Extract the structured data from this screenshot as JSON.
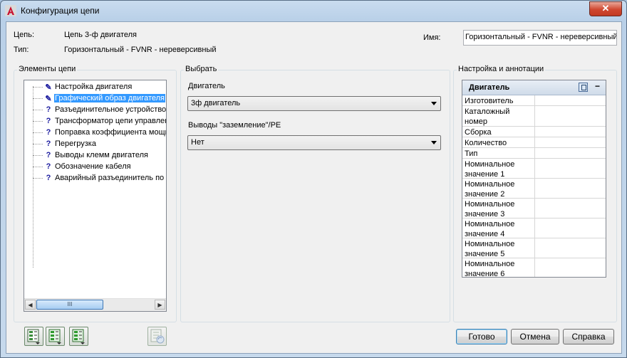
{
  "window": {
    "title": "Конфигурация цепи",
    "close_symbol": "✕"
  },
  "info": {
    "circuit_label": "Цепь:",
    "circuit_value": "Цепь 3-ф двигателя",
    "type_label": "Тип:",
    "type_value": "Горизонтальный - FVNR - нереверсивный",
    "name_label": "Имя:",
    "name_value": "Горизонтальный - FVNR - нереверсивный"
  },
  "elements_group": {
    "title": "Элементы цепи",
    "items": [
      {
        "icon": "pencil-icon",
        "label": "Настройка двигателя",
        "selected": false
      },
      {
        "icon": "pencil-icon",
        "label": "Графический образ двигателя",
        "selected": true
      },
      {
        "icon": "question-icon",
        "label": "Разъединительное устройство",
        "selected": false
      },
      {
        "icon": "question-icon",
        "label": "Трансформатор цепи управлен",
        "selected": false
      },
      {
        "icon": "question-icon",
        "label": "Поправка коэффициента мощн",
        "selected": false
      },
      {
        "icon": "question-icon",
        "label": "Перегрузка",
        "selected": false
      },
      {
        "icon": "question-icon",
        "label": "Выводы клемм двигателя",
        "selected": false
      },
      {
        "icon": "question-icon",
        "label": "Обозначение кабеля",
        "selected": false
      },
      {
        "icon": "question-icon",
        "label": "Аварийный разъединитель по",
        "selected": false
      }
    ],
    "scroll": {
      "left": "◀",
      "right": "▶",
      "thumb": "III"
    }
  },
  "select_group": {
    "title": "Выбрать",
    "motor_label": "Двигатель",
    "motor_value": "3ф двигатель",
    "ground_label": "Выводы \"заземление\"/PE",
    "ground_value": "Нет"
  },
  "annotation_group": {
    "title": "Настройка и аннотации",
    "header": "Двигатель",
    "collapse": "−",
    "rows": [
      "Изготовитель",
      "Каталожный номер",
      "Сборка",
      "Количество",
      "Тип",
      "Номинальное значение 1",
      "Номинальное значение 2",
      "Номинальное значение 3",
      "Номинальное значение 4",
      "Номинальное значение 5",
      "Номинальное значение 6"
    ]
  },
  "buttons": {
    "ok": "Готово",
    "cancel": "Отмена",
    "help": "Справка"
  },
  "colors": {
    "selection": "#3399ff",
    "title_bar": "#b9d0e8",
    "close_button": "#c23a22"
  }
}
